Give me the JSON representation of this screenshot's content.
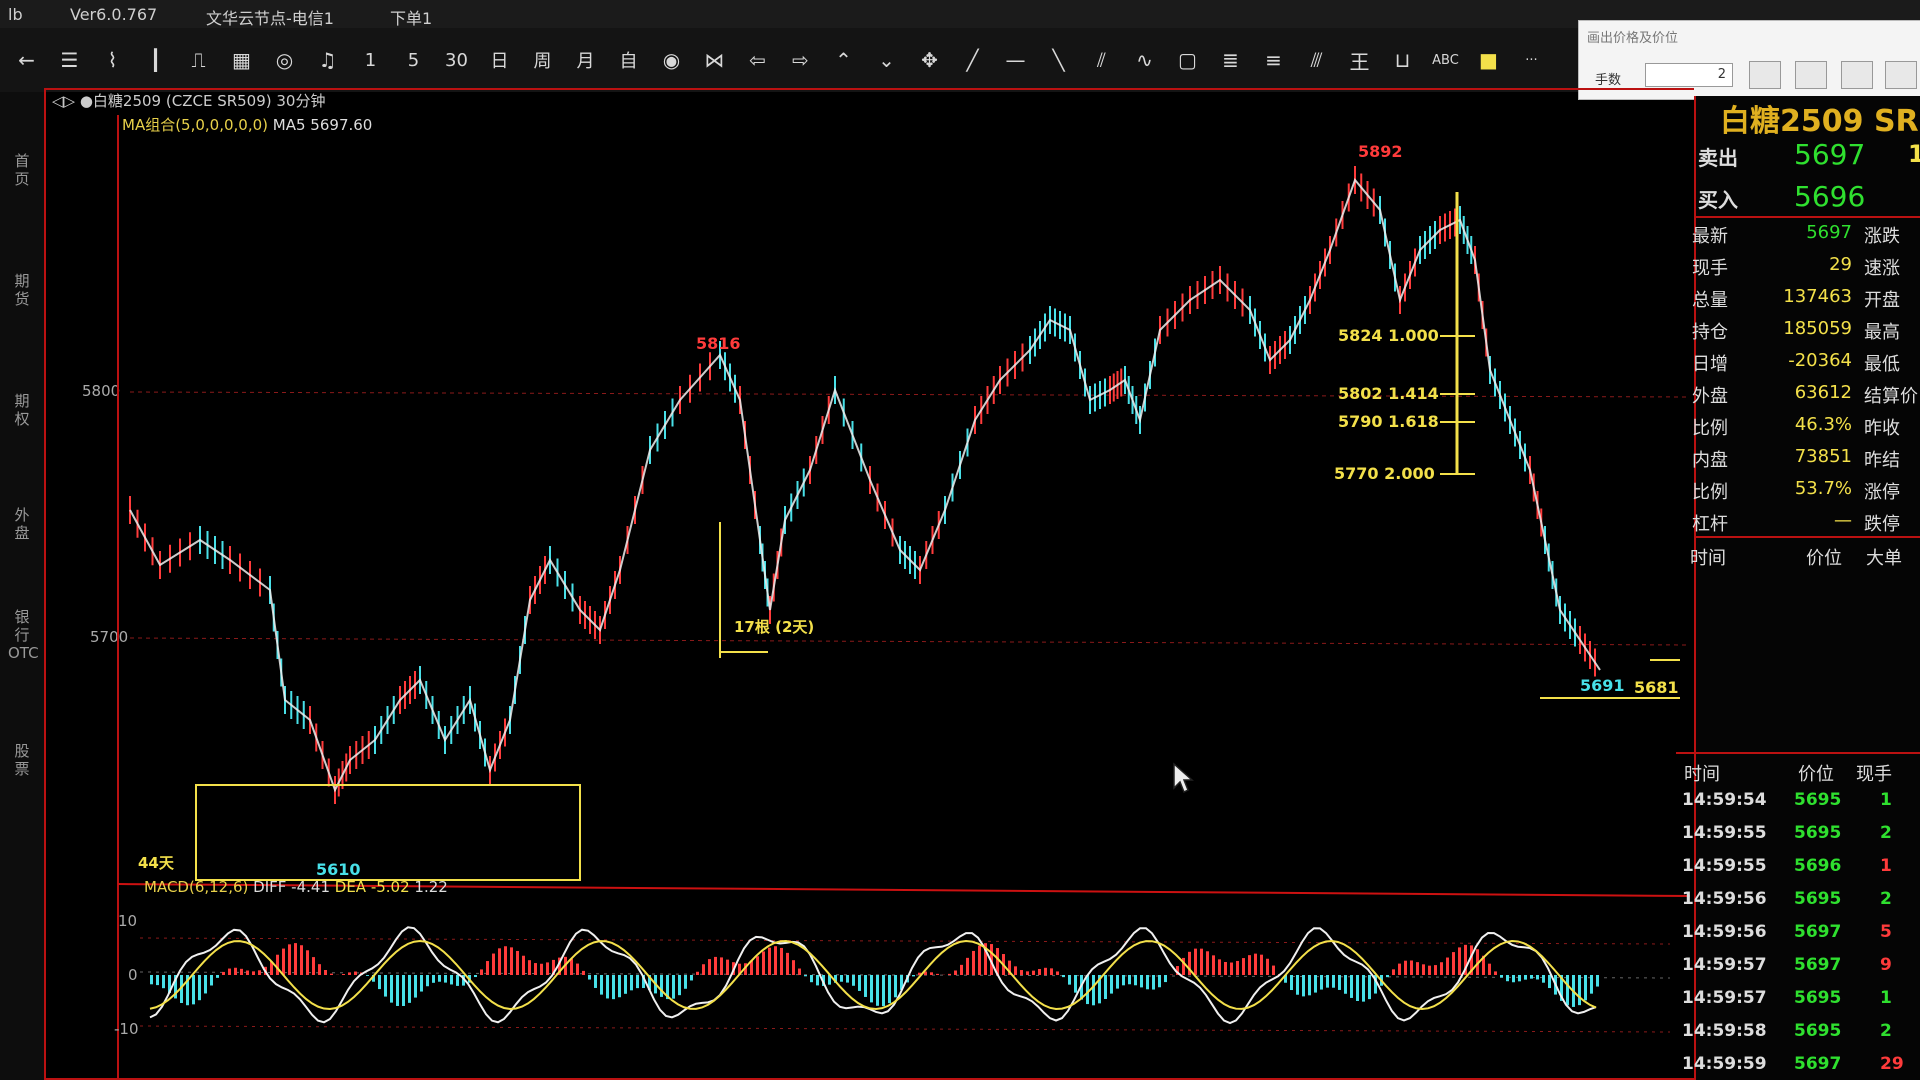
{
  "menubar": {
    "app_name": "lb",
    "version": "Ver6.0.767",
    "menu_cloud": "文华云节点-电信1",
    "menu_order": "下单1"
  },
  "toolbar": {
    "icons": [
      "back-arrow-icon",
      "list-icon",
      "line-chart-icon",
      "kline-icon",
      "step-icon",
      "grid-icon",
      "cycle-icon",
      "bell-icon",
      "period-1min",
      "period-5min",
      "period-30min",
      "period-day",
      "period-week",
      "period-month",
      "period-custom",
      "eye-icon",
      "zoom-icon",
      "arrow-left-icon",
      "arrow-right-icon",
      "double-up-icon",
      "double-down-icon",
      "move-icon",
      "line-icon",
      "hline-icon",
      "diag-line-icon",
      "parallel-icon",
      "wave-icon",
      "rect-icon",
      "fib-icon",
      "gann-icon",
      "channel-icon",
      "cross-icon",
      "measure-icon",
      "abc-label",
      "color-square-icon",
      "more-icon"
    ],
    "labels": {
      "period-1min": "1",
      "period-5min": "5",
      "period-30min": "30",
      "period-day": "日",
      "period-week": "周",
      "period-month": "月",
      "period-custom": "自",
      "abc-label": "ABC",
      "more-icon": "···"
    }
  },
  "order_panel": {
    "title": "画出价格及价位",
    "qty_label": "手数",
    "qty_value": "2"
  },
  "leftnav": {
    "items": [
      "首页",
      "期货",
      "期权",
      "外盘",
      "银行OTC",
      "股票"
    ]
  },
  "chart": {
    "header": "◁▷ ●白糖2509 (CZCE SR509) 30分钟",
    "ma_label": "MA组合(5,0,0,0,0,0)",
    "ma_value": "MA5 5697.60",
    "y_labels": [
      "5800",
      "5700"
    ],
    "annotations": {
      "high_label": "5892",
      "mid_high_label": "5816",
      "low_label": "5610",
      "last_label": "5691",
      "last_line_label": "5681",
      "days_44": "44天",
      "bars_17": "17根 (2天)",
      "fib": [
        {
          "price": "5824",
          "ratio": "1.000"
        },
        {
          "price": "5802",
          "ratio": "1.414"
        },
        {
          "price": "5790",
          "ratio": "1.618"
        },
        {
          "price": "5770",
          "ratio": "2.000"
        }
      ]
    },
    "colors": {
      "up": "#ff3b3b",
      "down": "#48e0e8",
      "ma": "#f3e04a",
      "box": "#f3e04a",
      "grid": "#8a1a1a"
    }
  },
  "macd": {
    "title": "MACD(6,12,6)",
    "diff": "DIFF -4.41",
    "dea": "DEA -5.02",
    "macd_val": "1.22",
    "y_labels": [
      "10",
      "0",
      "-10"
    ]
  },
  "quote": {
    "title": "白糖2509  SR",
    "sell_label": "卖出",
    "sell_price": "5697",
    "sell_extra": "1",
    "buy_label": "买入",
    "buy_price": "5696",
    "rows": [
      {
        "k": "最新",
        "v": "5697",
        "vcolor": "#2fe02f",
        "k2": "涨跌"
      },
      {
        "k": "现手",
        "v": "29",
        "vcolor": "#f3e04a",
        "k2": "速涨"
      },
      {
        "k": "总量",
        "v": "137463",
        "vcolor": "#f3e04a",
        "k2": "开盘"
      },
      {
        "k": "持仓",
        "v": "185059",
        "vcolor": "#f3e04a",
        "k2": "最高"
      },
      {
        "k": "日增",
        "v": "-20364",
        "vcolor": "#f3e04a",
        "k2": "最低"
      },
      {
        "k": "外盘",
        "v": "63612",
        "vcolor": "#f3e04a",
        "k2": "结算价"
      },
      {
        "k": "比例",
        "v": "46.3%",
        "vcolor": "#f3e04a",
        "k2": "昨收"
      },
      {
        "k": "内盘",
        "v": "73851",
        "vcolor": "#f3e04a",
        "k2": "昨结"
      },
      {
        "k": "比例",
        "v": "53.7%",
        "vcolor": "#f3e04a",
        "k2": "涨停"
      },
      {
        "k": "杠杆",
        "v": "—",
        "vcolor": "#f3e04a",
        "k2": "跌停"
      }
    ],
    "big_order_head": {
      "time": "时间",
      "price": "价位",
      "big": "大单"
    },
    "ticks_head": {
      "time": "时间",
      "price": "价位",
      "vol": "现手"
    },
    "ticks": [
      {
        "t": "14:59:54",
        "p": "5695",
        "pc": "#2fe02f",
        "v": "1",
        "vc": "#2fe02f"
      },
      {
        "t": "14:59:55",
        "p": "5695",
        "pc": "#2fe02f",
        "v": "2",
        "vc": "#2fe02f"
      },
      {
        "t": "14:59:55",
        "p": "5696",
        "pc": "#2fe02f",
        "v": "1",
        "vc": "#ff3b3b"
      },
      {
        "t": "14:59:56",
        "p": "5695",
        "pc": "#2fe02f",
        "v": "2",
        "vc": "#2fe02f"
      },
      {
        "t": "14:59:56",
        "p": "5697",
        "pc": "#2fe02f",
        "v": "5",
        "vc": "#ff3b3b"
      },
      {
        "t": "14:59:57",
        "p": "5697",
        "pc": "#2fe02f",
        "v": "9",
        "vc": "#ff3b3b"
      },
      {
        "t": "14:59:57",
        "p": "5695",
        "pc": "#2fe02f",
        "v": "1",
        "vc": "#2fe02f"
      },
      {
        "t": "14:59:58",
        "p": "5695",
        "pc": "#2fe02f",
        "v": "2",
        "vc": "#2fe02f"
      },
      {
        "t": "14:59:59",
        "p": "5697",
        "pc": "#2fe02f",
        "v": "29",
        "vc": "#ff3b3b"
      }
    ]
  }
}
